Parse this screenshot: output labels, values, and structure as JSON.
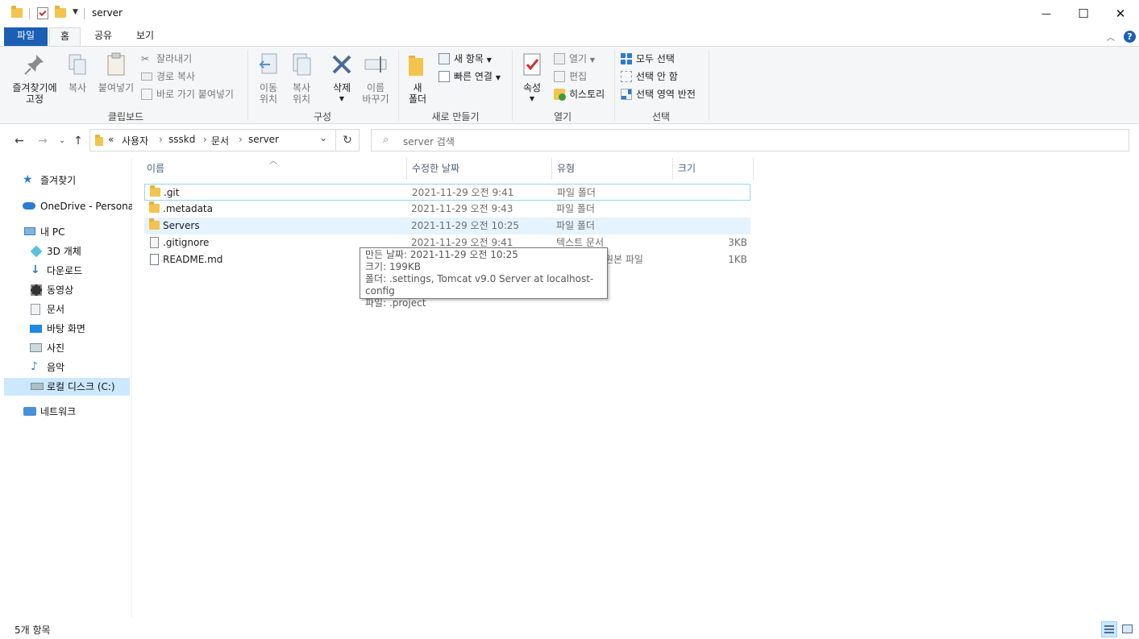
{
  "window": {
    "title": "server",
    "minimize": "—",
    "maximize": "☐",
    "close": "✕"
  },
  "ribbon_tabs": [
    {
      "label": "파일"
    },
    {
      "label": "홈"
    },
    {
      "label": "공유"
    },
    {
      "label": "보기"
    }
  ],
  "ribbon": {
    "clipboard": {
      "pin_label": "즐겨찾기에\n고정",
      "copy_label": "복사",
      "paste_label": "붙여넣기",
      "cut_label": "잘라내기",
      "copy_path_label": "경로 복사",
      "paste_shortcut_label": "바로 가기 붙여넣기",
      "group_label": "클립보드"
    },
    "organize": {
      "move_label": "이동\n위치",
      "copyto_label": "복사\n위치",
      "delete_label": "삭제",
      "rename_label": "이름\n바꾸기",
      "group_label": "구성"
    },
    "new": {
      "new_folder_label": "새\n폴더",
      "new_item_label": "새 항목",
      "easy_access_label": "빠른 연결",
      "group_label": "새로 만들기"
    },
    "open": {
      "properties_label": "속성",
      "open_label": "열기",
      "edit_label": "편집",
      "history_label": "히스토리",
      "group_label": "열기"
    },
    "select": {
      "select_all_label": "모두 선택",
      "select_none_label": "선택 안 함",
      "invert_label": "선택 영역 반전",
      "group_label": "선택"
    }
  },
  "address": {
    "overflow": "«",
    "crumbs": [
      "사용자",
      "ssskd",
      "문서",
      "server"
    ],
    "search_placeholder": "server 검색"
  },
  "nav_pane": {
    "items": [
      {
        "label": "즐겨찾기",
        "icon": "star-icon"
      },
      {
        "label": "OneDrive - Personal",
        "icon": "cloud-icon"
      },
      {
        "label": "내 PC",
        "icon": "pc-icon"
      },
      {
        "label": "3D 개체",
        "icon": "cube-icon"
      },
      {
        "label": "다운로드",
        "icon": "download-icon"
      },
      {
        "label": "동영상",
        "icon": "video-icon"
      },
      {
        "label": "문서",
        "icon": "document-icon"
      },
      {
        "label": "바탕 화면",
        "icon": "desktop-icon"
      },
      {
        "label": "사진",
        "icon": "picture-icon"
      },
      {
        "label": "음악",
        "icon": "music-icon"
      },
      {
        "label": "로컬 디스크 (C:)",
        "icon": "drive-icon"
      },
      {
        "label": "네트워크",
        "icon": "network-icon"
      }
    ]
  },
  "file_list": {
    "columns": [
      "이름",
      "수정한 날짜",
      "유형",
      "크기"
    ],
    "rows": [
      {
        "name": ".git",
        "date": "2021-11-29 오전 9:41",
        "type": "파일 폴더",
        "size": "",
        "icon": "folder-icon"
      },
      {
        "name": ".metadata",
        "date": "2021-11-29 오전 9:43",
        "type": "파일 폴더",
        "size": "",
        "icon": "folder-icon"
      },
      {
        "name": "Servers",
        "date": "2021-11-29 오전 10:25",
        "type": "파일 폴더",
        "size": "",
        "icon": "folder-icon"
      },
      {
        "name": ".gitignore",
        "date": "2021-11-29 오전 9:41",
        "type": "텍스트 문서",
        "size": "3KB",
        "icon": "text-file-icon"
      },
      {
        "name": "README.md",
        "date": "",
        "type": "원본 파일",
        "size": "1KB",
        "icon": "md-file-icon"
      }
    ]
  },
  "tooltip": {
    "line1": "만든 날짜: 2021-11-29 오전 10:25",
    "line2": "크기: 199KB",
    "line3": "폴더: .settings, Tomcat v9.0 Server at localhost-config",
    "line4": "파일: .project"
  },
  "status": {
    "item_count": "5개 항목"
  },
  "colors": {
    "accent": "#1a5fb4",
    "selection": "#cce8ff",
    "hover": "#e5f3ff",
    "folder": "#f3c44e"
  }
}
